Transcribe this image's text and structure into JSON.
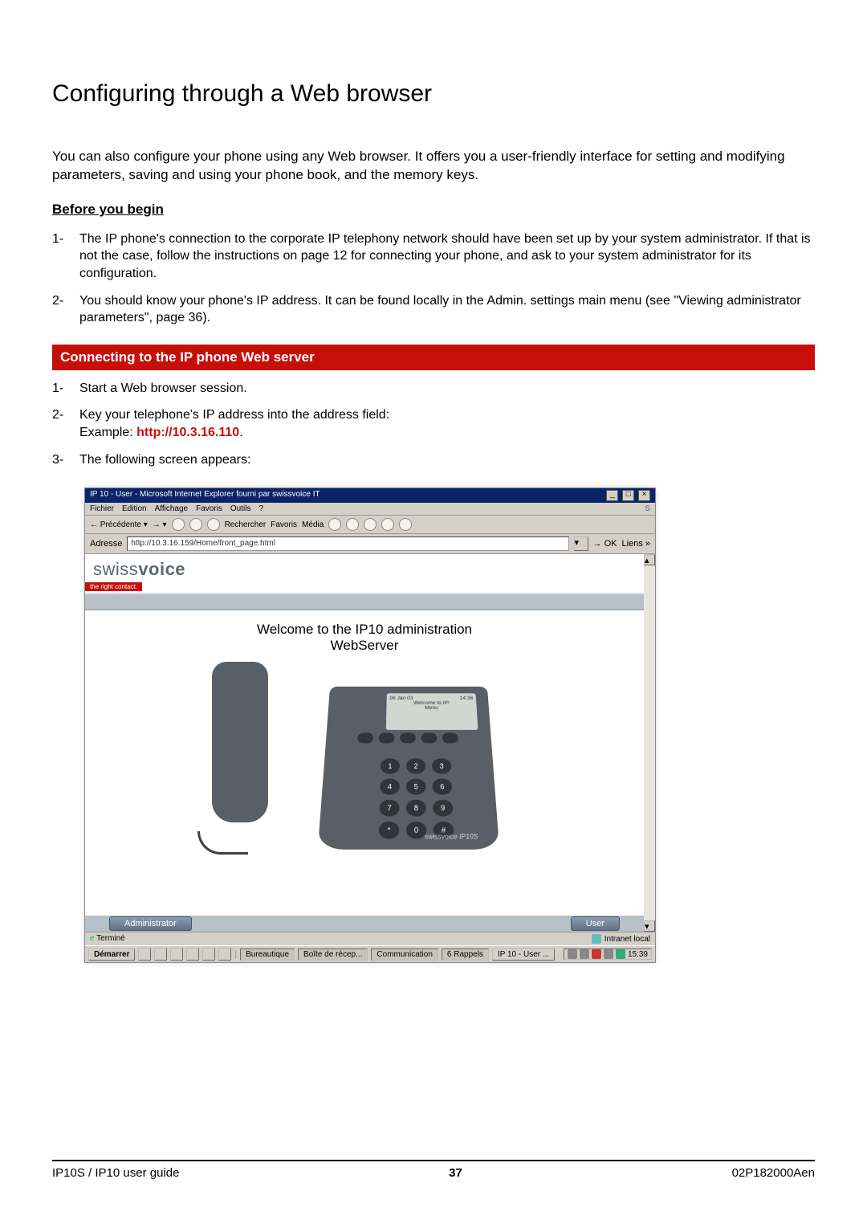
{
  "title": "Configuring through a Web browser",
  "intro": "You can also configure your phone using any Web browser. It offers you a user-friendly interface for setting and modifying parameters, saving and using your phone book, and the memory keys.",
  "before_heading": "Before you begin",
  "before_items": [
    "The IP phone's connection to the corporate IP telephony network should have been set up by your system administrator. If that is not the case, follow the instructions on page 12 for connecting your phone, and ask to your system administrator for its configuration.",
    "You should know your phone's IP address. It can be found locally in the Admin. settings main menu (see \"Viewing administrator parameters\", page 36)."
  ],
  "connect_heading": "Connecting to the IP phone Web server",
  "connect_items": {
    "i1": "Start a Web browser session.",
    "i2_a": "Key your telephone's IP address into the address field:",
    "i2_b_label": "Example: ",
    "i2_b_url": "http://10.3.16.110",
    "i2_b_suffix": ".",
    "i3": "The following screen appears:"
  },
  "browser": {
    "title": "IP 10 - User - Microsoft Internet Explorer fourni par swissvoice IT",
    "menus": [
      "Fichier",
      "Edition",
      "Affichage",
      "Favoris",
      "Outils",
      "?"
    ],
    "toolbar": {
      "back": "Précédente",
      "search": "Rechercher",
      "favorites": "Favoris",
      "media": "Média"
    },
    "address_label": "Adresse",
    "address_value": "http://10.3.16.159/Home/front_page.html",
    "ok_label": "OK",
    "liens": "Liens",
    "ie_logo": "e",
    "s_logo": "S",
    "brand_prefix": "swiss",
    "brand_suffix": "voice",
    "brand_tag": "the right contact.",
    "welcome_line1": "Welcome to the IP10 administration",
    "welcome_line2": "WebServer",
    "phone_screen_line1": "06 Jan 03",
    "phone_screen_time": "14:38",
    "phone_screen_line2": "Welcome to IP!",
    "phone_screen_line3": "Menu",
    "model": "swissvoice IP10S",
    "keypad": [
      "1",
      "2",
      "3",
      "4",
      "5",
      "6",
      "7",
      "8",
      "9",
      "*",
      "0",
      "#"
    ],
    "admin_btn": "Administrator",
    "user_btn": "User",
    "status_left": "Terminé",
    "status_right": "Intranet local"
  },
  "taskbar": {
    "start": "Démarrer",
    "tasks": [
      "Bureautique",
      "Boîte de récep...",
      "Communication",
      "6 Rappels",
      "IP 10 - User ..."
    ],
    "time": "15:39"
  },
  "footer": {
    "left": "IP10S / IP10 user guide",
    "center": "37",
    "right": "02P182000Aen"
  }
}
